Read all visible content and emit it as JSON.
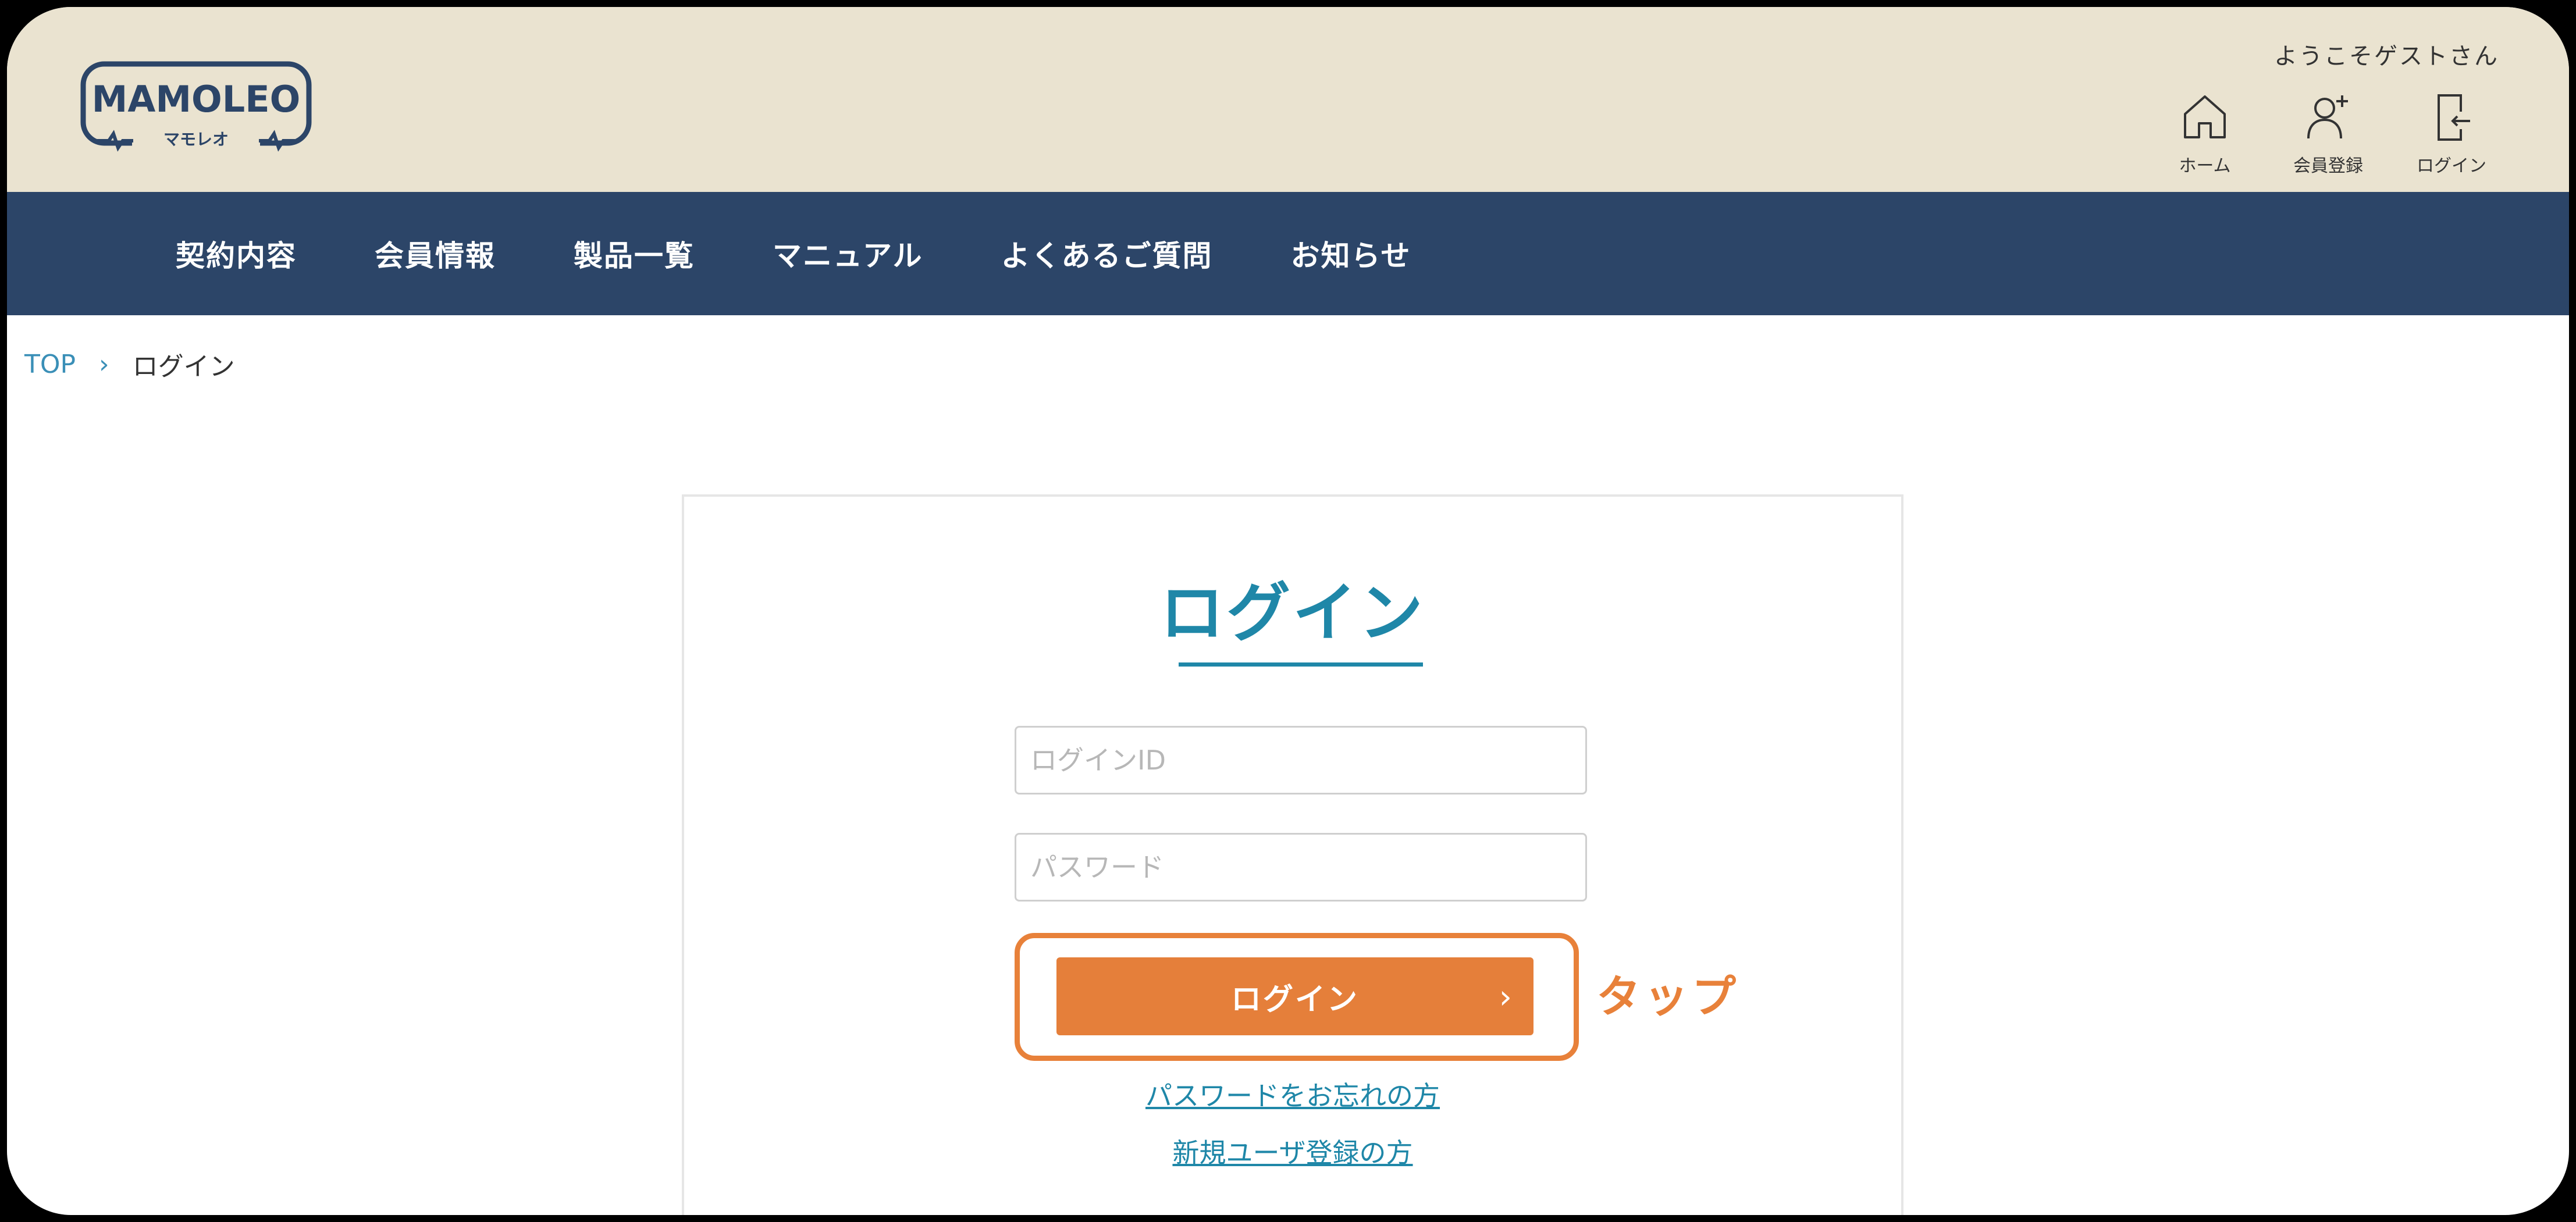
{
  "header": {
    "logo_text": "MAMOLEO",
    "logo_sub": "マモレオ",
    "welcome": "ようこそゲストさん",
    "icons": [
      {
        "label": "ホーム",
        "icon": "home-icon"
      },
      {
        "label": "会員登録",
        "icon": "user-add-icon"
      },
      {
        "label": "ログイン",
        "icon": "login-door-icon"
      }
    ]
  },
  "nav": {
    "items": [
      "契約内容",
      "会員情報",
      "製品一覧",
      "マニュアル",
      "よくあるご質問",
      "お知らせ"
    ]
  },
  "breadcrumb": {
    "top": "TOP",
    "current": "ログイン"
  },
  "login": {
    "title": "ログイン",
    "id_placeholder": "ログインID",
    "password_placeholder": "パスワード",
    "button_label": "ログイン",
    "tap_annotation": "タップ",
    "forgot_link": "パスワードをお忘れの方",
    "register_link": "新規ユーザ登録の方"
  },
  "colors": {
    "header_bg": "#eae3d0",
    "nav_bg": "#2c4568",
    "accent_teal": "#1f87a8",
    "button_orange": "#e57f3a"
  }
}
